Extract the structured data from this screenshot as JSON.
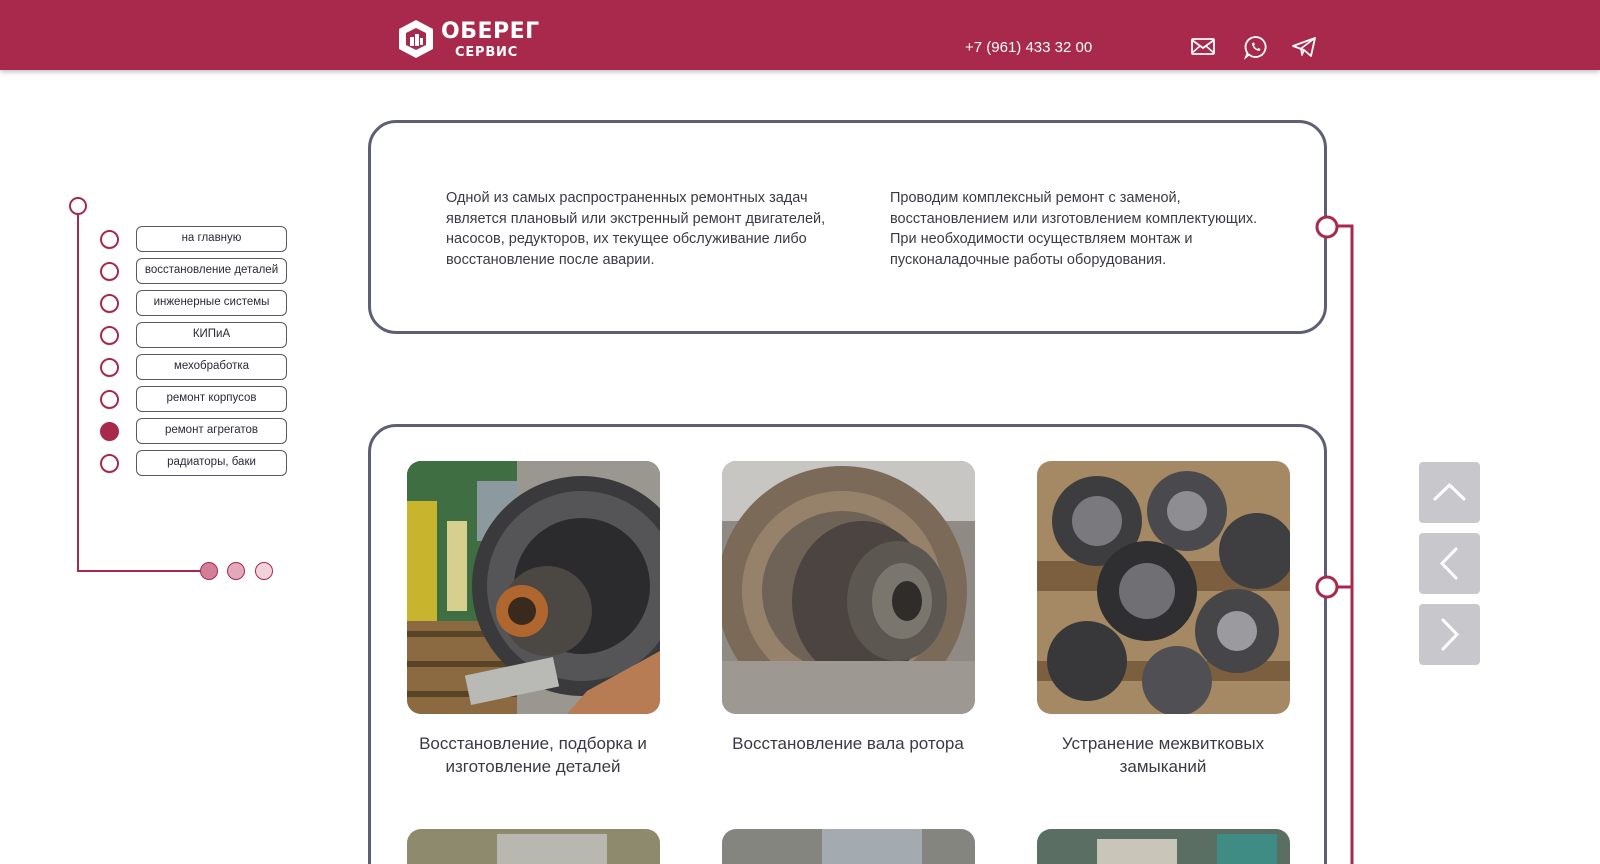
{
  "header": {
    "brand_name": "ОБЕРЕГ",
    "brand_sub": "СЕРВИС",
    "phone": "+7 (961) 433 32 00",
    "icons": [
      "mail-icon",
      "whatsapp-icon",
      "telegram-icon"
    ]
  },
  "colors": {
    "brand": "#a8294b",
    "frame": "#5e5f75",
    "control": "#c8c8cc"
  },
  "sidebar": {
    "items": [
      {
        "label": "на главную",
        "active": false
      },
      {
        "label": "восстановление деталей",
        "active": false
      },
      {
        "label": "инженерные системы",
        "active": false
      },
      {
        "label": "КИПиА",
        "active": false
      },
      {
        "label": "мехобработка",
        "active": false
      },
      {
        "label": "ремонт корпусов",
        "active": false
      },
      {
        "label": "ремонт агрегатов",
        "active": true
      },
      {
        "label": "радиаторы, баки",
        "active": false
      }
    ],
    "pager": {
      "pages": 3,
      "current": 1
    }
  },
  "info": {
    "left_text": "Одной из самых распространенных ремонтных задач является плановый или экстренный ремонт двигателей, насосов, редукторов, их текущее обслуживание либо восстановление после аварии.",
    "right_text": "Проводим комплексный ремонт с заменой, восстановлением или изготовлением комплектующих. При необходимости осуществляем монтаж и пусконаладочные работы оборудования."
  },
  "gallery": {
    "items": [
      {
        "caption": "Восстановление, подборка и изготовление деталей"
      },
      {
        "caption": "Восстановление вала ротора"
      },
      {
        "caption": "Устранение межвитковых замыканий"
      }
    ]
  },
  "controls": [
    "chevron-up-icon",
    "chevron-left-icon",
    "chevron-right-icon"
  ]
}
